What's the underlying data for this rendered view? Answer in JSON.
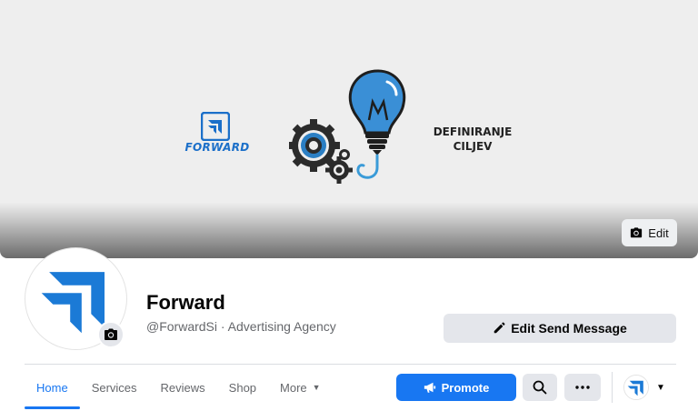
{
  "cover": {
    "brand_text": "FORWARD",
    "caption_line1": "DEFINIRANJE",
    "caption_line2": "CILJEV",
    "edit_label": "Edit"
  },
  "profile": {
    "name": "Forward",
    "subtitle": "@ForwardSi · Advertising Agency",
    "send_message_label": "Edit Send Message"
  },
  "tabs": [
    {
      "label": "Home",
      "active": true
    },
    {
      "label": "Services",
      "active": false
    },
    {
      "label": "Reviews",
      "active": false
    },
    {
      "label": "Shop",
      "active": false
    },
    {
      "label": "More",
      "active": false
    }
  ],
  "actions": {
    "promote_label": "Promote",
    "search_icon": "search-icon",
    "more_icon": "ellipsis-icon"
  },
  "colors": {
    "accent": "#1877f2",
    "brand_blue": "#1b6fc9",
    "button_gray": "#e4e6eb"
  }
}
